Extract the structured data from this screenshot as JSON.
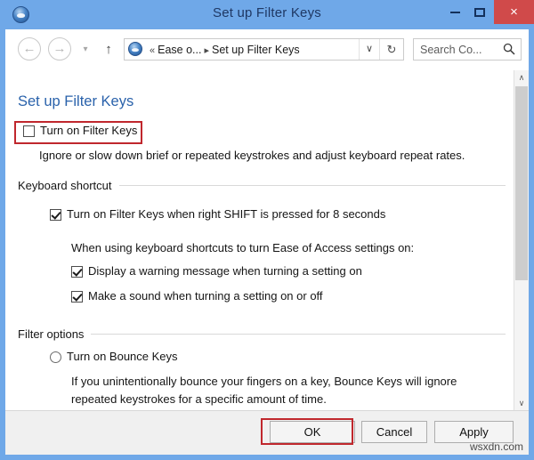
{
  "window": {
    "title": "Set up Filter Keys",
    "icon": "ease-of-access-icon",
    "controls": {
      "minimize": "minimize-icon",
      "maximize": "maximize-icon",
      "close": "×"
    }
  },
  "navbar": {
    "back": "←",
    "forward": "→",
    "recent": "▾",
    "up": "↑",
    "refresh": "↻",
    "dropdown": "∨",
    "breadcrumb": {
      "overflow": "«",
      "parent": "Ease o...",
      "separator": "▸",
      "current": "Set up Filter Keys"
    },
    "search": {
      "placeholder": "Search Co...",
      "icon": "search-icon"
    }
  },
  "content": {
    "heading": "Set up Filter Keys",
    "filter_keys": {
      "label": "Turn on Filter Keys",
      "checked": false,
      "description": "Ignore or slow down brief or repeated keystrokes and adjust keyboard repeat rates."
    },
    "keyboard_shortcut": {
      "group_label": "Keyboard shortcut",
      "shortcut_label": "Turn on Filter Keys when right SHIFT is pressed for 8 seconds",
      "shortcut_checked": true,
      "sub_note": "When using keyboard shortcuts to turn Ease of Access settings on:",
      "options": [
        {
          "label": "Display a warning message when turning a setting on",
          "checked": true
        },
        {
          "label": "Make a sound when turning a setting on or off",
          "checked": true
        }
      ]
    },
    "filter_options": {
      "group_label": "Filter options",
      "bounce_keys_label": "Turn on Bounce Keys",
      "bounce_keys_selected": false,
      "bounce_keys_description_line1": "If you unintentionally bounce your fingers on a key, Bounce Keys will ignore",
      "bounce_keys_description_line2": "repeated keystrokes for a specific amount of time."
    }
  },
  "scrollbar": {
    "up_arrow": "∧",
    "down_arrow": "∨"
  },
  "footer": {
    "ok": "OK",
    "cancel": "Cancel",
    "apply": "Apply"
  },
  "watermark": "wsxdn.com",
  "colors": {
    "title_bar": "#6fa8e8",
    "close_button": "#d04a4a",
    "heading_blue": "#2a62ab",
    "annotation_red": "#c0272d"
  }
}
